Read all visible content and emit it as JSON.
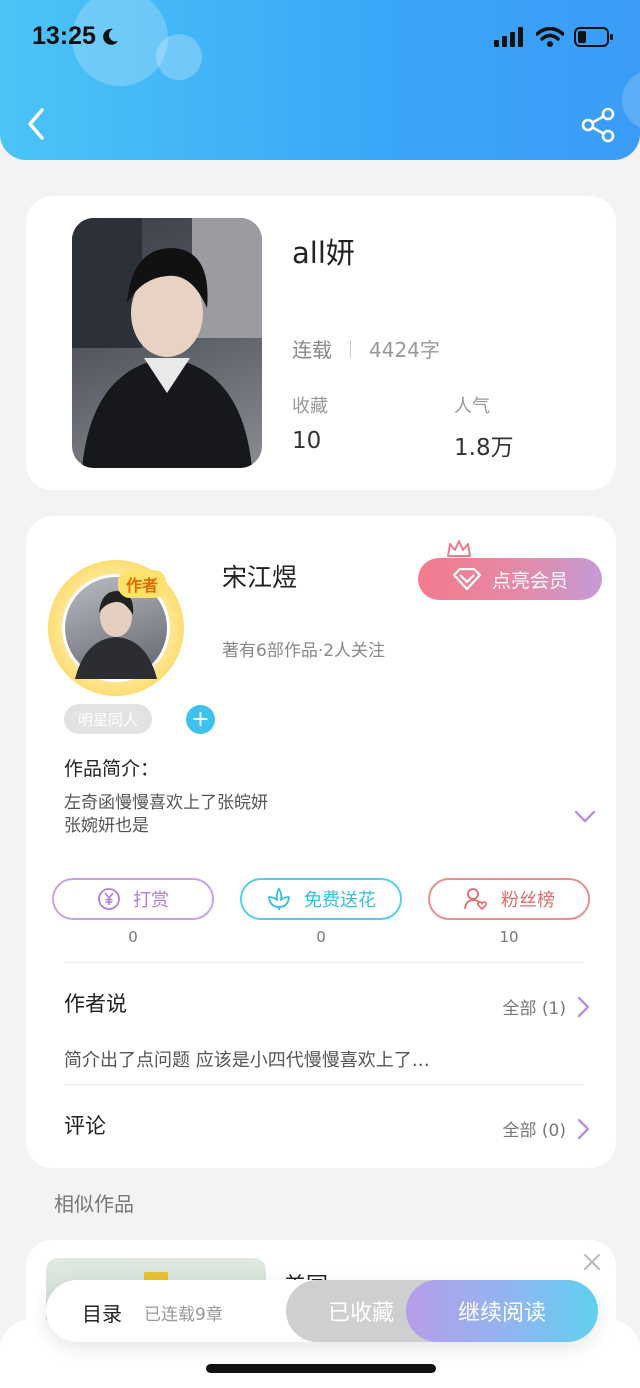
{
  "status_bar": {
    "time": "13:25"
  },
  "book": {
    "title": "all妍",
    "status": "连载",
    "word_count": "4424字",
    "favorites_label": "收藏",
    "favorites_value": "10",
    "popularity_label": "人气",
    "popularity_value": "1.8万"
  },
  "author": {
    "badge": "作者",
    "name": "宋江煜",
    "subtitle": "著有6部作品·2人关注",
    "vip_button": "点亮会员",
    "tag": "明星同人",
    "add_tag": "+"
  },
  "intro": {
    "label": "作品简介：",
    "line1": "左奇函慢慢喜欢上了张皖妍",
    "line2": "张婉妍也是"
  },
  "actions": [
    {
      "label": "打赏",
      "count": "0",
      "icon": "yen-icon",
      "color": "#b17fdb"
    },
    {
      "label": "免费送花",
      "count": "0",
      "icon": "flower-icon",
      "color": "#33bfe1"
    },
    {
      "label": "粉丝榜",
      "count": "10",
      "icon": "fan-icon",
      "color": "#df6b6e"
    }
  ],
  "author_says": {
    "title": "作者说",
    "more": "全部 (1)",
    "text": "简介出了点问题 应该是小四代慢慢喜欢上了…"
  },
  "comments": {
    "title": "评论",
    "more": "全部 (0)"
  },
  "similar": {
    "label": "相似作品",
    "first_title": "美园"
  },
  "bottom_bar": {
    "toc": "目录",
    "serial": "已连载9章",
    "favorited": "已收藏",
    "continue": "继续阅读"
  }
}
